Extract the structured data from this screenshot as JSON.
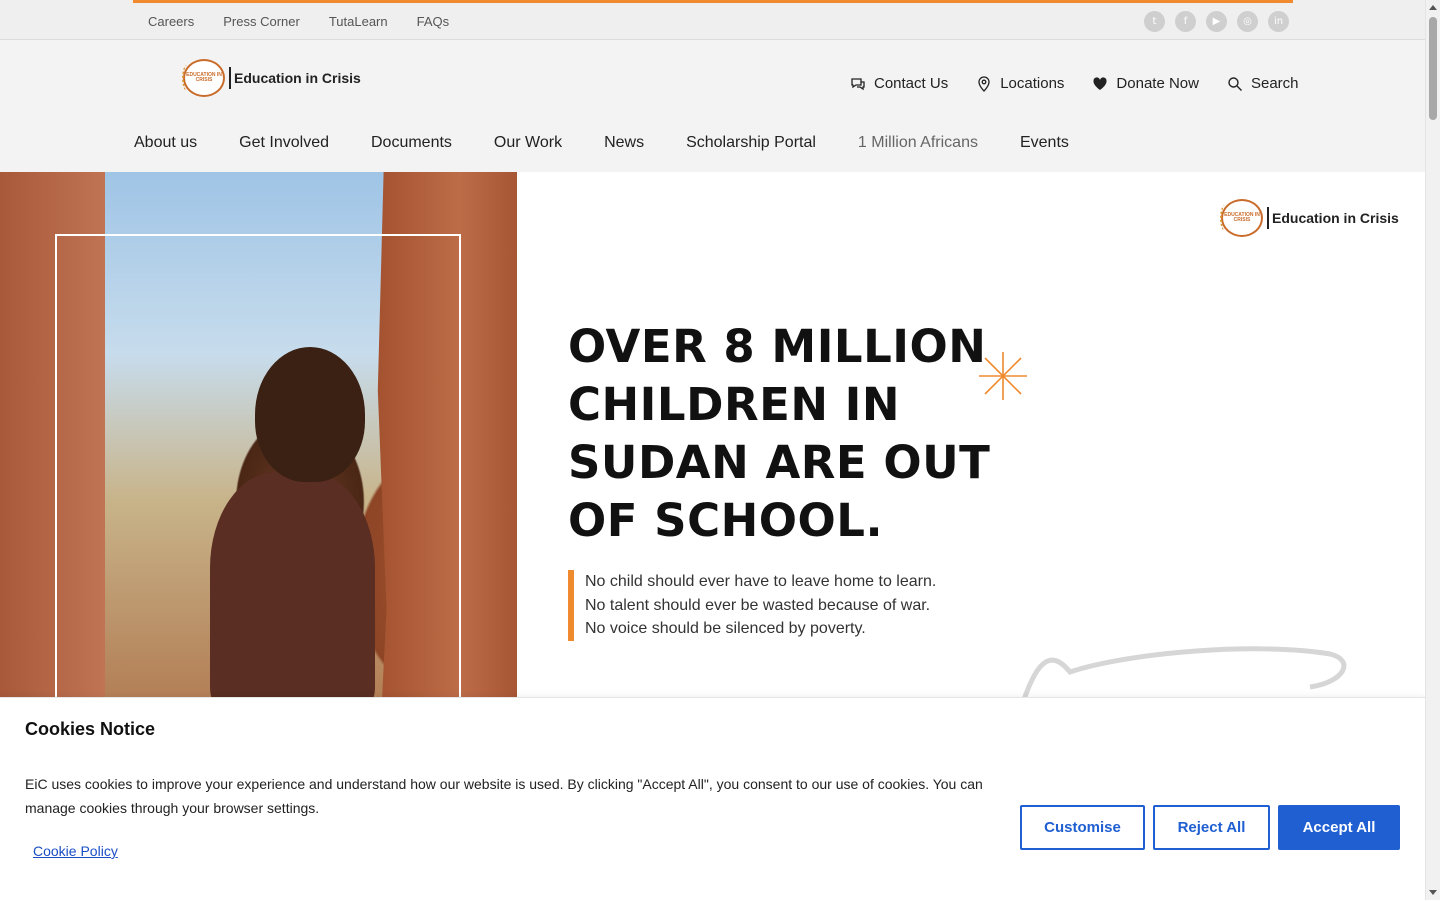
{
  "topbar": {
    "links": [
      "Careers",
      "Press Corner",
      "TutaLearn",
      "FAQs"
    ],
    "socials": [
      {
        "icon": "twitter-icon",
        "glyph": "t"
      },
      {
        "icon": "facebook-icon",
        "glyph": "f"
      },
      {
        "icon": "youtube-icon",
        "glyph": "▶"
      },
      {
        "icon": "instagram-icon",
        "glyph": "◎"
      },
      {
        "icon": "linkedin-icon",
        "glyph": "in"
      }
    ]
  },
  "logo": {
    "circle_text": "EDUCATION IN CRISIS",
    "name": "Education in Crisis"
  },
  "utility": {
    "contact": "Contact Us",
    "locations": "Locations",
    "donate": "Donate Now",
    "search": "Search"
  },
  "nav": [
    "About us",
    "Get Involved",
    "Documents",
    "Our Work",
    "News",
    "Scholarship Portal",
    "1 Million Africans",
    "Events"
  ],
  "hero": {
    "headline": [
      "OVER 8 MILLION",
      "CHILDREN IN",
      "SUDAN ARE OUT",
      "OF SCHOOL."
    ],
    "quote": [
      "No child should ever have to leave home to learn.",
      "No talent should ever be wasted because of war.",
      "No voice should be silenced by poverty."
    ]
  },
  "cookie": {
    "title": "Cookies Notice",
    "text": "EiC uses cookies to improve your experience and understand how our website is used. By clicking \"Accept All\", you consent to our use of cookies. You can manage cookies through your browser settings.",
    "policy_link": "Cookie Policy",
    "customise": "Customise",
    "reject": "Reject All",
    "accept": "Accept All"
  },
  "colors": {
    "accent": "#ef8a2e",
    "button_blue": "#1f5fd1",
    "link_blue": "#1a4fc4"
  }
}
